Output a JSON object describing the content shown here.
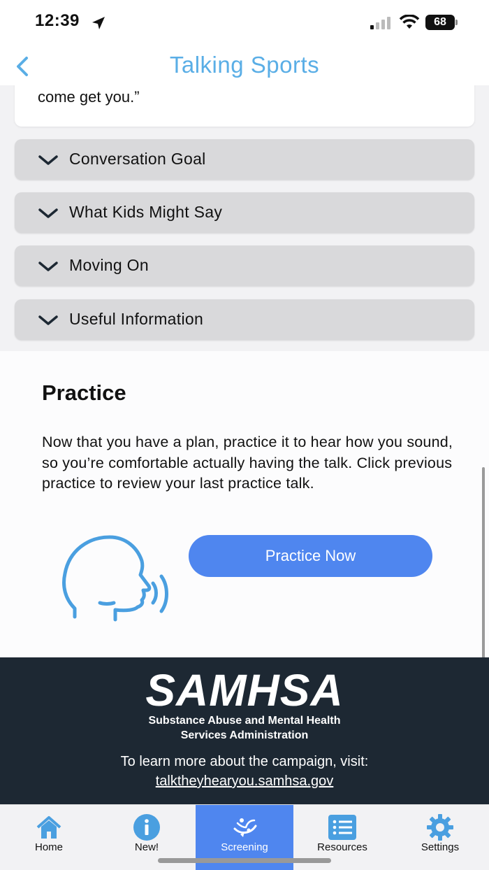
{
  "status_bar": {
    "time": "12:39",
    "battery": "68"
  },
  "nav": {
    "title": "Talking Sports"
  },
  "quote": {
    "text": "come get you.”"
  },
  "accordions": [
    {
      "label": "Conversation Goal"
    },
    {
      "label": "What Kids Might Say"
    },
    {
      "label": "Moving On"
    },
    {
      "label": "Useful Information"
    }
  ],
  "practice": {
    "title": "Practice",
    "text": "Now that you have a plan, practice it to hear how you sound, so you’re comfortable actually having the talk. Click previous practice to review your last practice talk.",
    "button_label": "Practice Now"
  },
  "footer": {
    "logo": "SAMHSA",
    "sub_line1": "Substance Abuse and Mental Health",
    "sub_line2": "Services Administration",
    "learn_text": "To learn more about the campaign, visit:",
    "link": "talktheyhearyou.samhsa.gov"
  },
  "tabs": [
    {
      "label": "Home",
      "icon": "home-icon"
    },
    {
      "label": "New!",
      "icon": "info-icon"
    },
    {
      "label": "Screening",
      "icon": "screening-icon",
      "active": true
    },
    {
      "label": "Resources",
      "icon": "list-icon"
    },
    {
      "label": "Settings",
      "icon": "gear-icon"
    }
  ],
  "colors": {
    "accent": "#4f86ef",
    "title": "#5aaee6",
    "footer": "#1d2833",
    "icon_blue": "#4a9fe0"
  }
}
